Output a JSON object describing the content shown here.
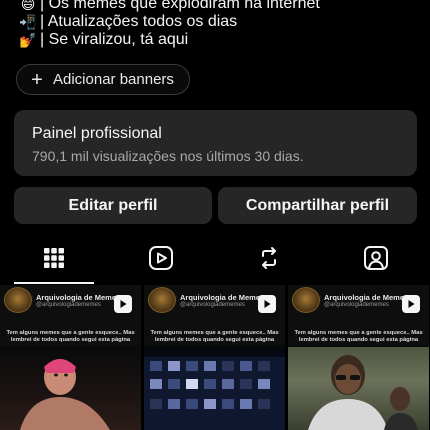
{
  "bio": {
    "lines": [
      {
        "emoji": "😄",
        "text": "| Os memes que explodiram na internet"
      },
      {
        "emoji": "📲",
        "text": "| Atualizações todos os dias"
      },
      {
        "emoji": "💅",
        "text": "| Se viralizou, tá aqui"
      }
    ]
  },
  "banners": {
    "label": "Adicionar banners"
  },
  "panel": {
    "title": "Painel profissional",
    "subtitle": "790,1 mil visualizações nos últimos 30 dias."
  },
  "buttons": {
    "edit": "Editar perfil",
    "share": "Compartilhar perfil"
  },
  "tabs": [
    {
      "icon": "grid-icon",
      "active": true
    },
    {
      "icon": "reels-icon",
      "active": false
    },
    {
      "icon": "repost-icon",
      "active": false
    },
    {
      "icon": "tagged-icon",
      "active": false
    }
  ],
  "posts": [
    {
      "account": "Arquivologia de Memes",
      "handle": "@arquivologiadememes",
      "caption": "Tem alguns memes que a gente esquece.. Mas lembrei de todos quando segui esta página",
      "icon": "reel-icon"
    },
    {
      "account": "Arquivologia de Memes",
      "handle": "@arquivologiadememes",
      "caption": "Tem alguns memes que a gente esquece.. Mas lembrei de todos quando segui esta página",
      "icon": "reel-icon"
    },
    {
      "account": "Arquivologia de Memes",
      "handle": "@arquivologiadememes",
      "caption": "Tem alguns memes que a gente esquece.. Mas lembrei de todos quando segui esta página",
      "icon": "reel-icon"
    }
  ],
  "colors": {
    "background": "#000000",
    "card": "#262626",
    "text": "#f5f5f5",
    "muted": "#a8a8a8"
  }
}
